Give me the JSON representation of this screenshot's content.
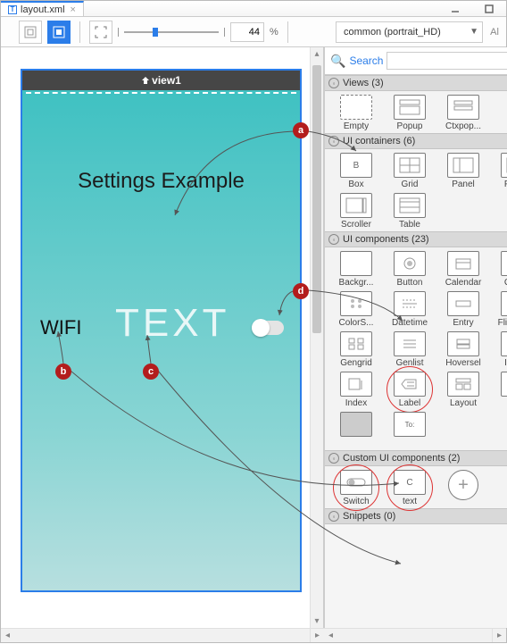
{
  "tab": {
    "filename": "layout.xml"
  },
  "toolbar": {
    "zoom_value": "44",
    "zoom_unit": "%",
    "device_mode": "common (portrait_HD)",
    "extra": "Al"
  },
  "canvas": {
    "view_name": "view1",
    "heading": "Settings Example",
    "wifi_label": "WIFI",
    "text_label": "TEXT"
  },
  "search": {
    "label": "Search",
    "placeholder": ""
  },
  "sections": {
    "views": {
      "title": "Views (3)",
      "items": [
        "Empty",
        "Popup",
        "Ctxpop..."
      ]
    },
    "containers": {
      "title": "UI containers (6)",
      "items": [
        "Box",
        "Grid",
        "Panel",
        "Panes",
        "Scroller",
        "Table"
      ]
    },
    "components": {
      "title": "UI components (23)",
      "items": [
        "Backgr...",
        "Button",
        "Calendar",
        "Check",
        "ColorS...",
        "Datetime",
        "Entry",
        "Flipsele...",
        "Gengrid",
        "Genlist",
        "Hoversel",
        "Image",
        "Index",
        "Label",
        "Layout"
      ]
    },
    "custom": {
      "title": "Custom UI components (2)",
      "items": [
        "Switch",
        "text"
      ]
    },
    "snippets": {
      "title": "Snippets (0)"
    }
  },
  "callouts": {
    "a": "a",
    "b": "b",
    "c": "c",
    "d": "d"
  }
}
